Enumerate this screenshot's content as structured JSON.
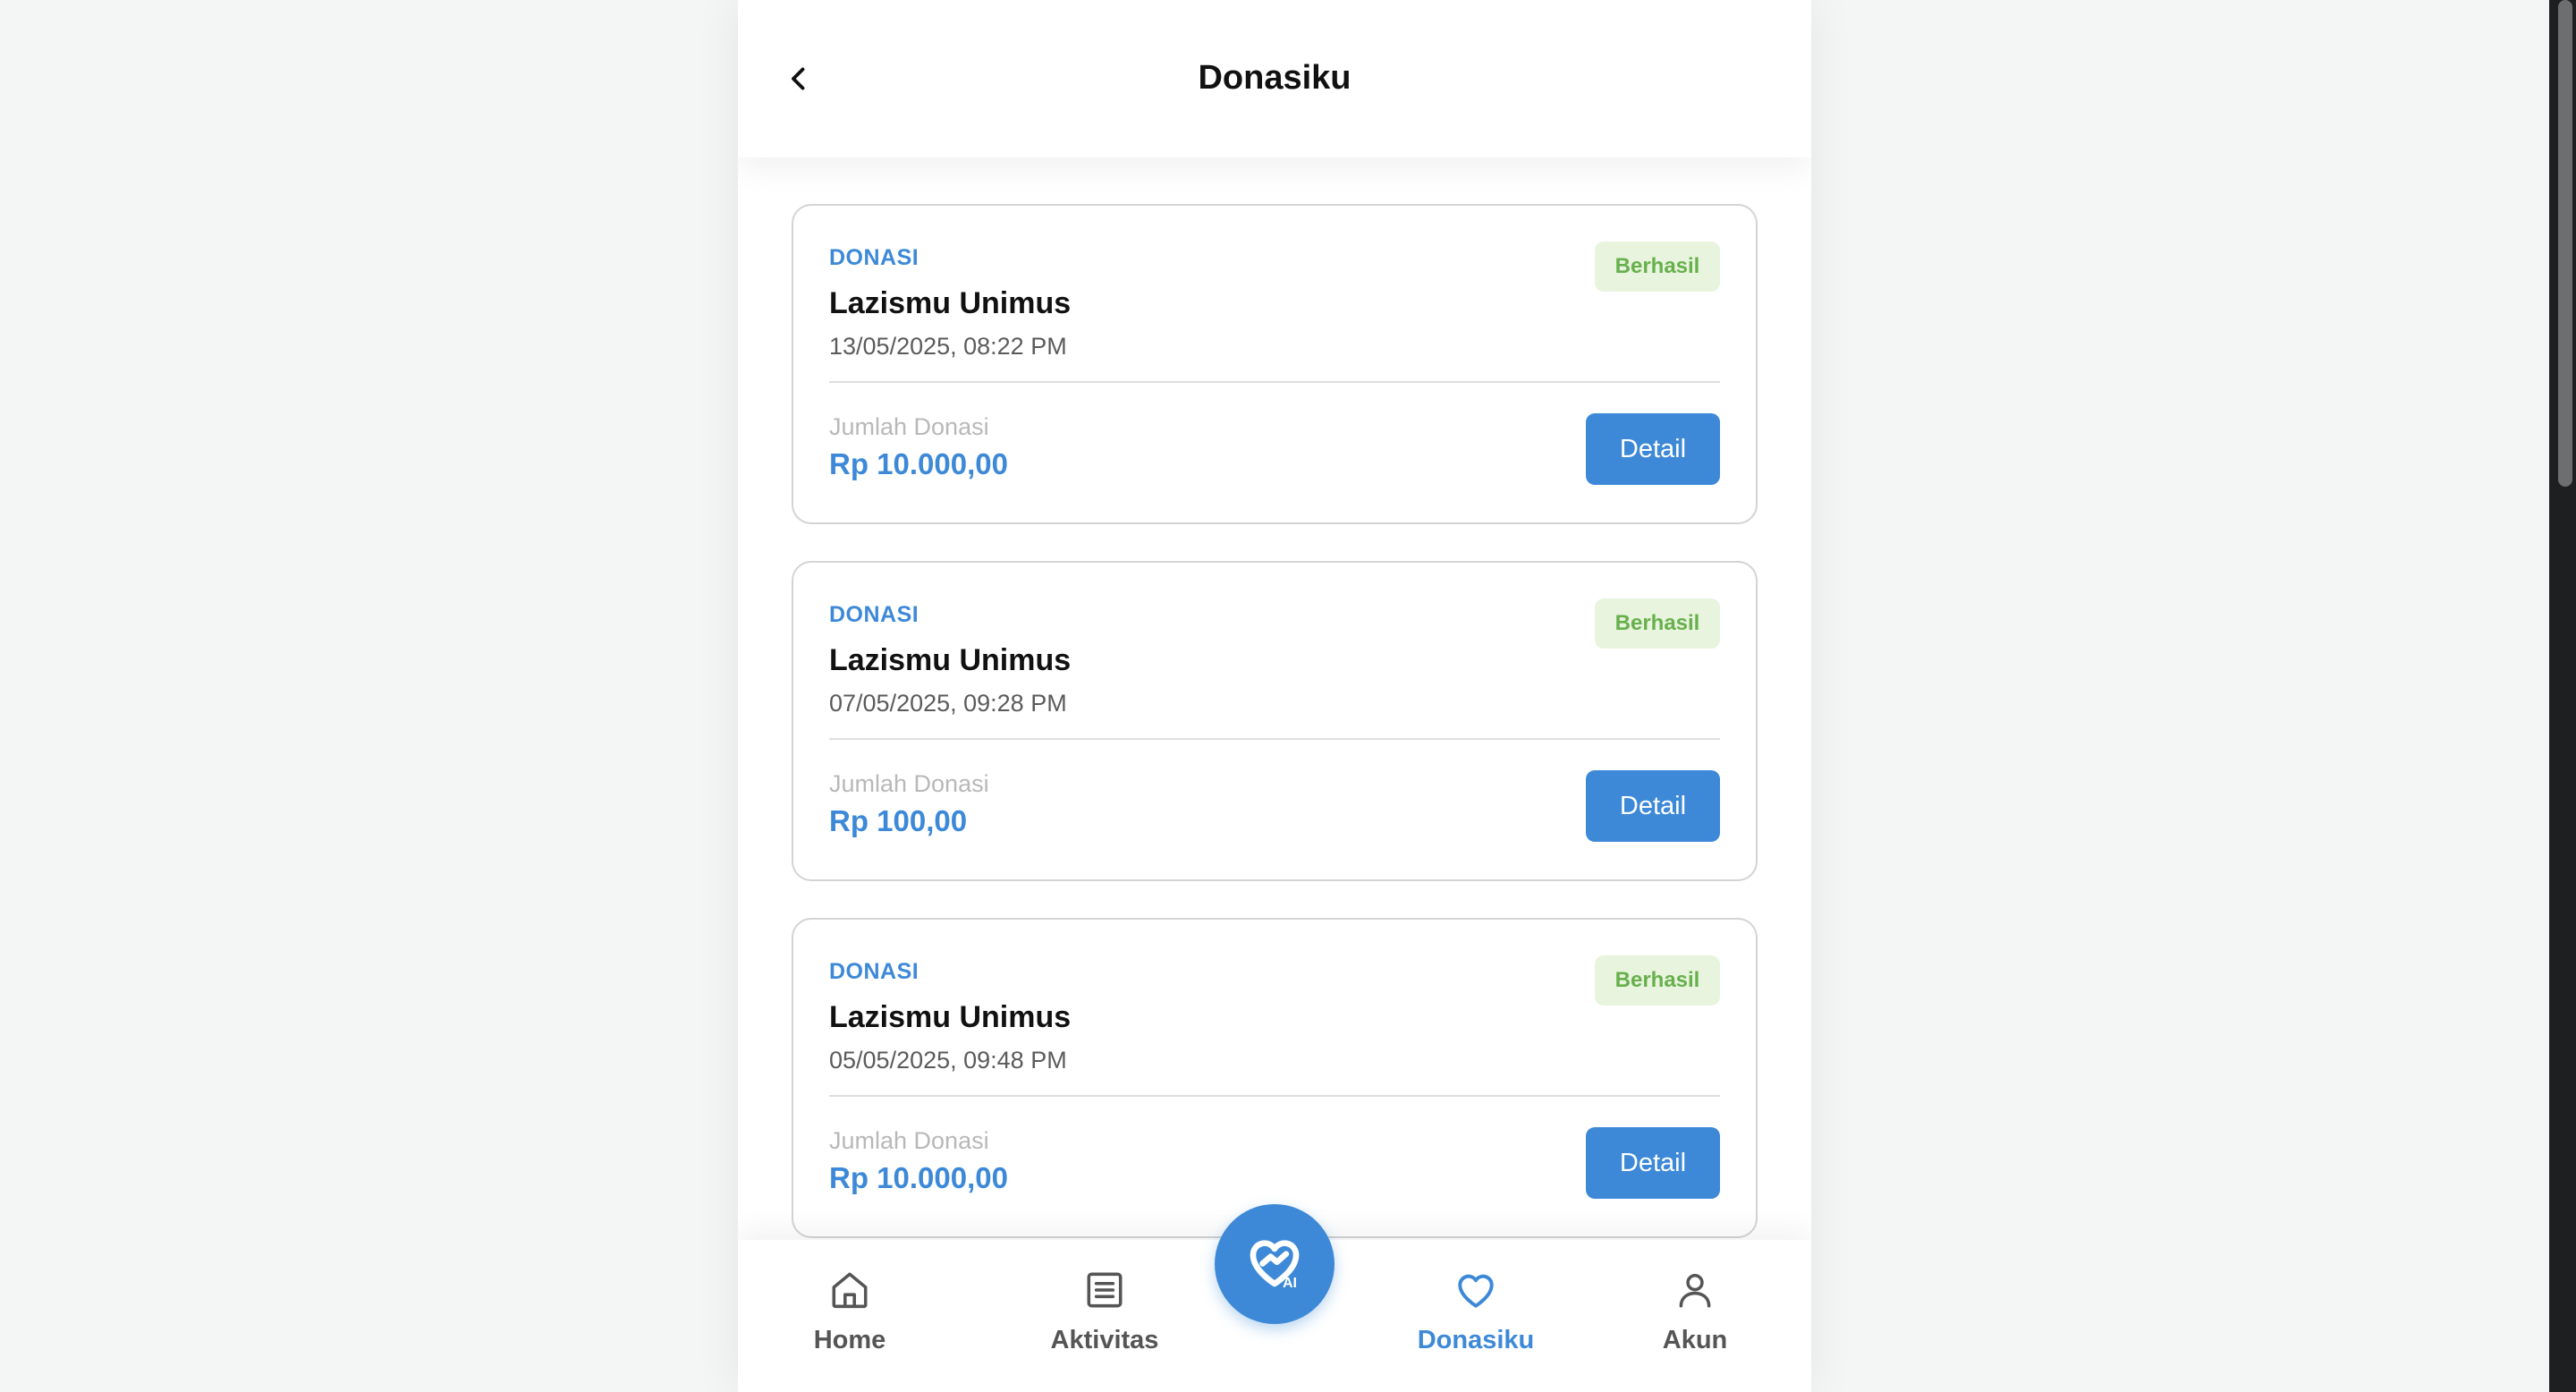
{
  "header": {
    "title": "Donasiku",
    "back_icon": "chevron-left-icon"
  },
  "donations": [
    {
      "category": "DONASI",
      "status": "Berhasil",
      "name": "Lazismu Unimus",
      "date": "13/05/2025, 08:22 PM",
      "amount_label": "Jumlah Donasi",
      "amount": "Rp 10.000,00",
      "detail_label": "Detail"
    },
    {
      "category": "DONASI",
      "status": "Berhasil",
      "name": "Lazismu Unimus",
      "date": "07/05/2025, 09:28 PM",
      "amount_label": "Jumlah Donasi",
      "amount": "Rp 100,00",
      "detail_label": "Detail"
    },
    {
      "category": "DONASI",
      "status": "Berhasil",
      "name": "Lazismu Unimus",
      "date": "05/05/2025, 09:48 PM",
      "amount_label": "Jumlah Donasi",
      "amount": "Rp 10.000,00",
      "detail_label": "Detail"
    }
  ],
  "bottom_nav": {
    "items": [
      {
        "label": "Home",
        "icon": "home-icon",
        "active": false
      },
      {
        "label": "Aktivitas",
        "icon": "list-icon",
        "active": false
      },
      {
        "label": "Donasiku",
        "icon": "heart-icon",
        "active": true
      },
      {
        "label": "Akun",
        "icon": "user-icon",
        "active": false
      }
    ],
    "fab": {
      "label": "AI",
      "icon": "heart-handshake-ai-icon"
    }
  },
  "colors": {
    "accent": "#3d89d8",
    "success_bg": "#e8f4dd",
    "success_text": "#67b04d",
    "nav_inactive": "#555555",
    "page_background": "#f4f6f5"
  }
}
